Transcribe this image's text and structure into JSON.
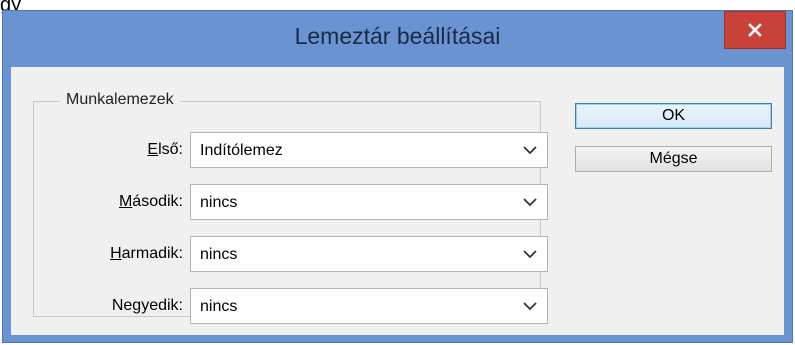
{
  "background_fragment": {
    "text": "gy"
  },
  "window": {
    "title": "Lemeztár beállításai",
    "close_icon": "close-x-icon",
    "colors": {
      "titlebar": "#6a93d1",
      "close": "#c9423a",
      "client": "#f0f0f0"
    }
  },
  "scratch_disks": {
    "legend": "Munkalemezek",
    "rows": [
      {
        "label_pre": "",
        "label_mn": "E",
        "label_post": "lső:",
        "value": "Indítólemez"
      },
      {
        "label_pre": "",
        "label_mn": "M",
        "label_post": "ásodik:",
        "value": "nincs"
      },
      {
        "label_pre": "",
        "label_mn": "H",
        "label_post": "armadik:",
        "value": "nincs"
      },
      {
        "label_pre": "Ne",
        "label_mn": "g",
        "label_post": "yedik:",
        "value": "nincs"
      }
    ],
    "dropdown_icon": "chevron-down-icon"
  },
  "buttons": {
    "ok": "OK",
    "cancel": "Mégse"
  }
}
